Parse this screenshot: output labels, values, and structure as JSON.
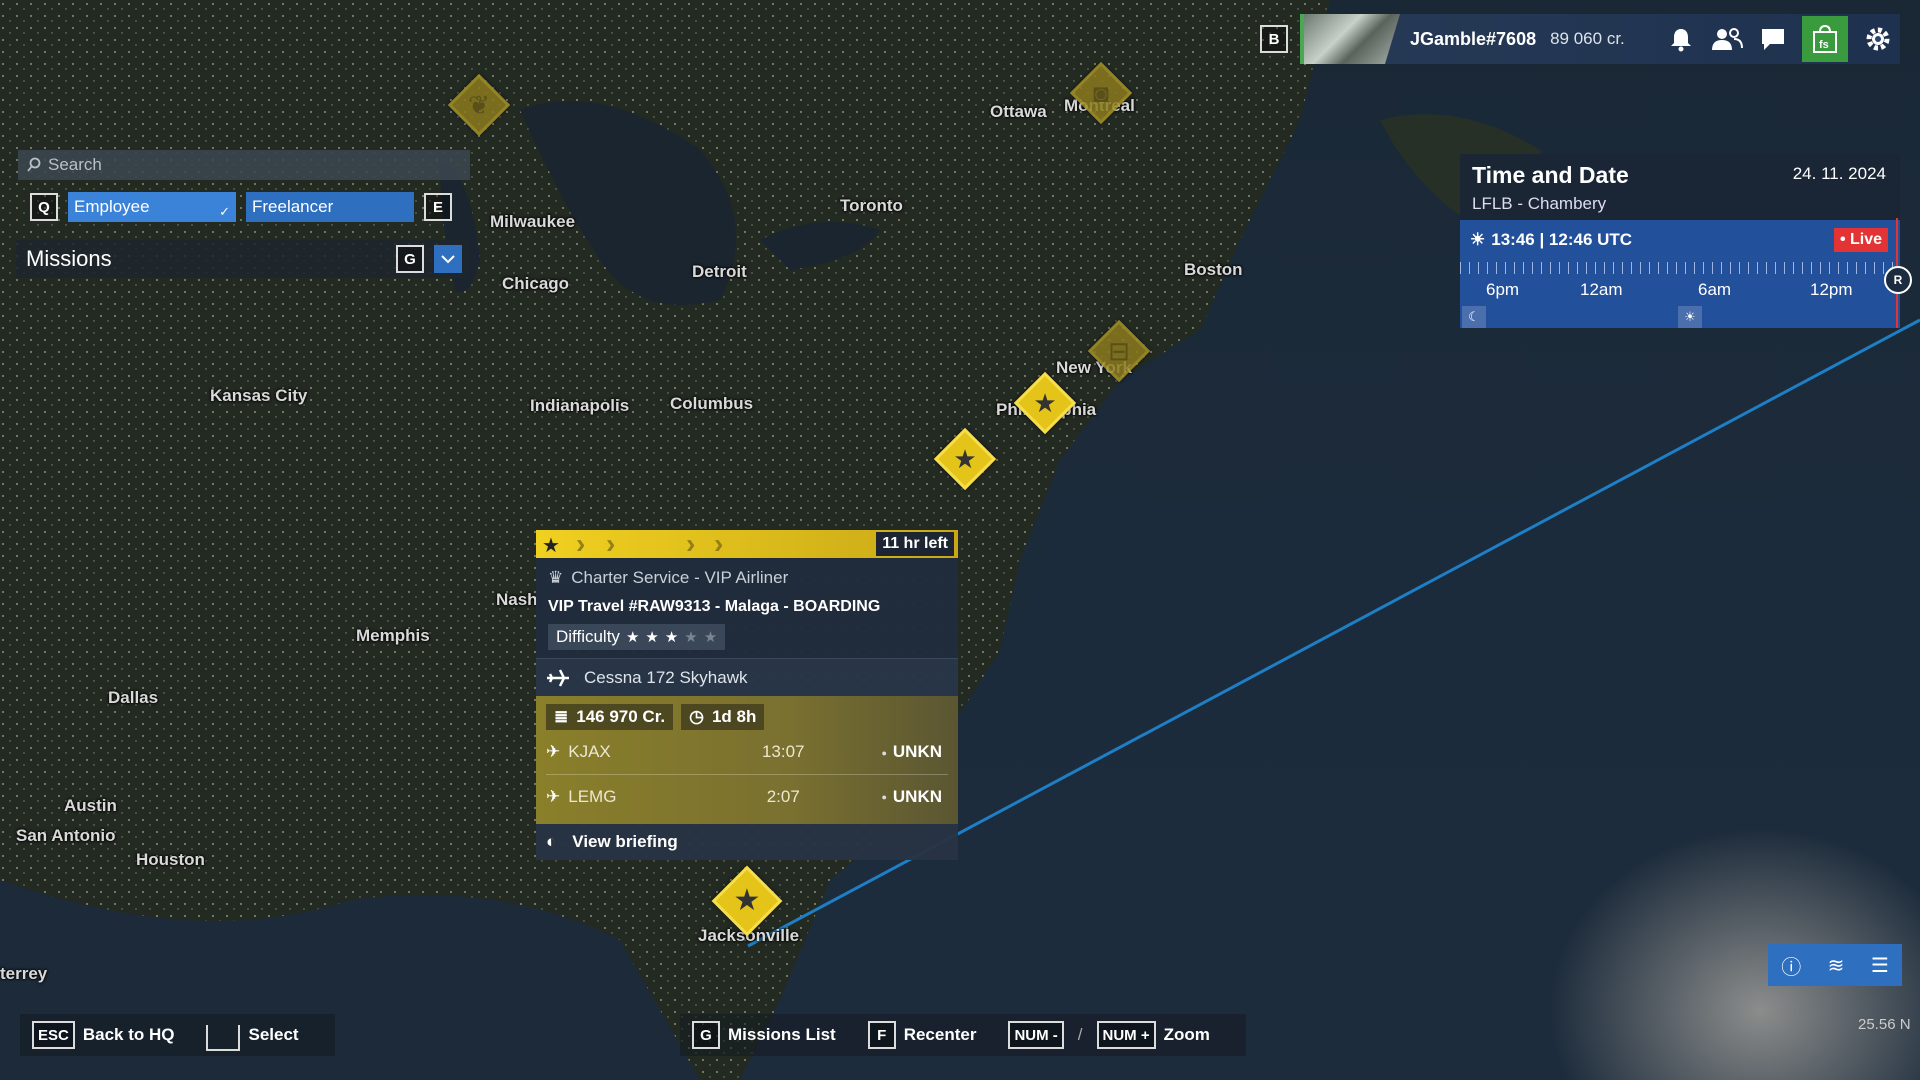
{
  "map": {
    "cities": [
      {
        "name": "Ottawa"
      },
      {
        "name": "Montreal"
      },
      {
        "name": "Toronto"
      },
      {
        "name": "Milwaukee"
      },
      {
        "name": "Chicago"
      },
      {
        "name": "Detroit"
      },
      {
        "name": "Boston"
      },
      {
        "name": "Kansas City"
      },
      {
        "name": "Indianapolis"
      },
      {
        "name": "Columbus"
      },
      {
        "name": "New York"
      },
      {
        "name": "Philadelphia"
      },
      {
        "name": "Nash"
      },
      {
        "name": "Memphis"
      },
      {
        "name": "Dallas"
      },
      {
        "name": "Austin"
      },
      {
        "name": "San Antonio"
      },
      {
        "name": "Houston"
      },
      {
        "name": "Jacksonville"
      },
      {
        "name": "terrey"
      }
    ],
    "markers": [
      {
        "icon": "wheat-icon",
        "dim": true
      },
      {
        "icon": "camera-icon",
        "dim": true
      },
      {
        "icon": "car-icon",
        "dim": true
      },
      {
        "icon": "star-icon",
        "dim": false
      },
      {
        "icon": "star-icon",
        "dim": false
      },
      {
        "icon": "star-icon",
        "dim": false
      }
    ],
    "route_color": "#1e7fc6"
  },
  "search": {
    "placeholder": "Search"
  },
  "filters": {
    "prev_key": "Q",
    "next_key": "E",
    "employee_label": "Employee",
    "freelancer_label": "Freelancer",
    "employee_active": true
  },
  "missions": {
    "title": "Missions",
    "key": "G"
  },
  "topbar": {
    "key": "B",
    "username": "JGamble#7608",
    "credits": "89 060 cr.",
    "icons": [
      "bell-icon",
      "friends-icon",
      "chat-icon",
      "shop-icon",
      "gear-icon"
    ]
  },
  "time_panel": {
    "title": "Time and Date",
    "date": "24. 11. 2024",
    "location": "LFLB - Chambery",
    "time": "13:46 | 12:46 UTC",
    "live_label": "• Live",
    "labels": [
      "6pm",
      "12am",
      "6am",
      "12pm"
    ],
    "knob": "R"
  },
  "mission_card": {
    "time_left": "11 hr left",
    "category": "Charter Service - VIP Airliner",
    "title": "VIP Travel #RAW9313 - Malaga - BOARDING",
    "difficulty_label": "Difficulty",
    "difficulty": 3,
    "difficulty_max": 5,
    "aircraft": "Cessna 172 Skyhawk",
    "reward": "146 970 Cr.",
    "duration": "1d 8h",
    "departure": {
      "icao": "KJAX",
      "time": "13:07",
      "status": "UNKN"
    },
    "arrival": {
      "icao": "LEMG",
      "time": "2:07",
      "status": "UNKN"
    },
    "briefing": "View briefing"
  },
  "hints": {
    "back_key": "ESC",
    "back_label": "Back to HQ",
    "select_label": "Select",
    "list_key": "G",
    "list_label": "Missions List",
    "recenter_key": "F",
    "recenter_label": "Recenter",
    "zoom_out_key": "NUM -",
    "zoom_sep": "/",
    "zoom_in_key": "NUM +",
    "zoom_label": "Zoom"
  },
  "scale": {
    "value": "25.56 N"
  },
  "accent": "#2e6fbf",
  "mission_yellow": "#e4c419"
}
